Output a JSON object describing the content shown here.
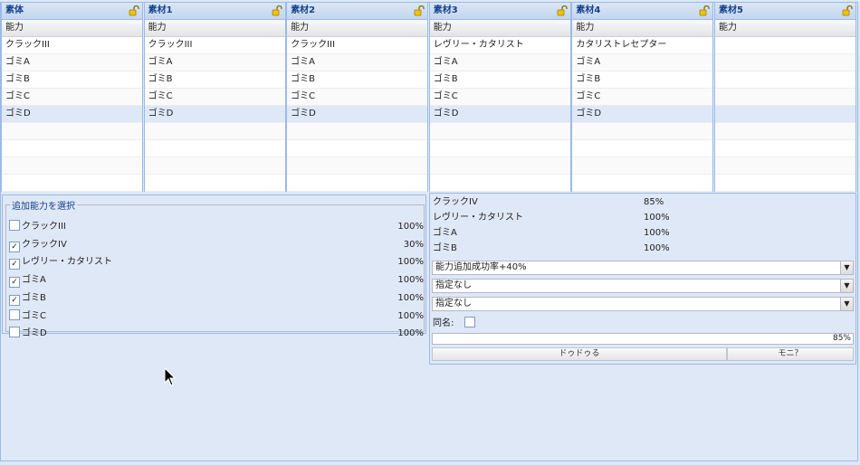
{
  "grids": [
    {
      "title": "素体",
      "header": "能力",
      "rows": [
        "クラックIII",
        "ゴミA",
        "ゴミB",
        "ゴミC",
        "ゴミD",
        "",
        "",
        "",
        ""
      ]
    },
    {
      "title": "素材1",
      "header": "能力",
      "rows": [
        "クラックIII",
        "ゴミA",
        "ゴミB",
        "ゴミC",
        "ゴミD",
        "",
        "",
        "",
        ""
      ]
    },
    {
      "title": "素材2",
      "header": "能力",
      "rows": [
        "クラックIII",
        "ゴミA",
        "ゴミB",
        "ゴミC",
        "ゴミD",
        "",
        "",
        "",
        ""
      ]
    },
    {
      "title": "素材3",
      "header": "能力",
      "rows": [
        "レヴリー・カタリスト",
        "ゴミA",
        "ゴミB",
        "ゴミC",
        "ゴミD",
        "",
        "",
        "",
        ""
      ]
    },
    {
      "title": "素材4",
      "header": "能力",
      "rows": [
        "カタリストレセプター",
        "ゴミA",
        "ゴミB",
        "ゴミC",
        "ゴミD",
        "",
        "",
        "",
        ""
      ]
    },
    {
      "title": "素材5",
      "header": "能力",
      "rows": [
        "",
        "",
        "",
        "",
        "",
        "",
        "",
        "",
        ""
      ]
    }
  ],
  "options": {
    "legend": "追加能力を選択",
    "items": [
      {
        "label": "クラックIII",
        "checked": false,
        "pct": "100%"
      },
      {
        "label": "クラックIV",
        "checked": true,
        "pct": "30%"
      },
      {
        "label": "レヴリー・カタリスト",
        "checked": true,
        "pct": "100%"
      },
      {
        "label": "ゴミA",
        "checked": true,
        "pct": "100%"
      },
      {
        "label": "ゴミB",
        "checked": true,
        "pct": "100%"
      },
      {
        "label": "ゴミC",
        "checked": false,
        "pct": "100%"
      },
      {
        "label": "ゴミD",
        "checked": false,
        "pct": "100%"
      }
    ]
  },
  "results": [
    {
      "label": "クラックIV",
      "pct": "85%"
    },
    {
      "label": "レヴリー・カタリスト",
      "pct": "100%"
    },
    {
      "label": "ゴミA",
      "pct": "100%"
    },
    {
      "label": "ゴミB",
      "pct": "100%"
    }
  ],
  "combos": [
    "能力追加成功率+40%",
    "指定なし",
    "指定なし"
  ],
  "same_name_label": "同名:",
  "progress": {
    "value": 0.85,
    "text": "85%"
  },
  "buttons": {
    "left": "ドゥドゥる",
    "right": "モニ？"
  },
  "colors": {
    "accent": "#15428b",
    "border": "#99bbe8",
    "background": "#dfe8f6"
  },
  "icons": {
    "lock": "unlock-icon",
    "checkbox": "checkbox-icon",
    "dropdown": "chevron-down-icon",
    "cursor": "mouse-cursor-icon"
  }
}
